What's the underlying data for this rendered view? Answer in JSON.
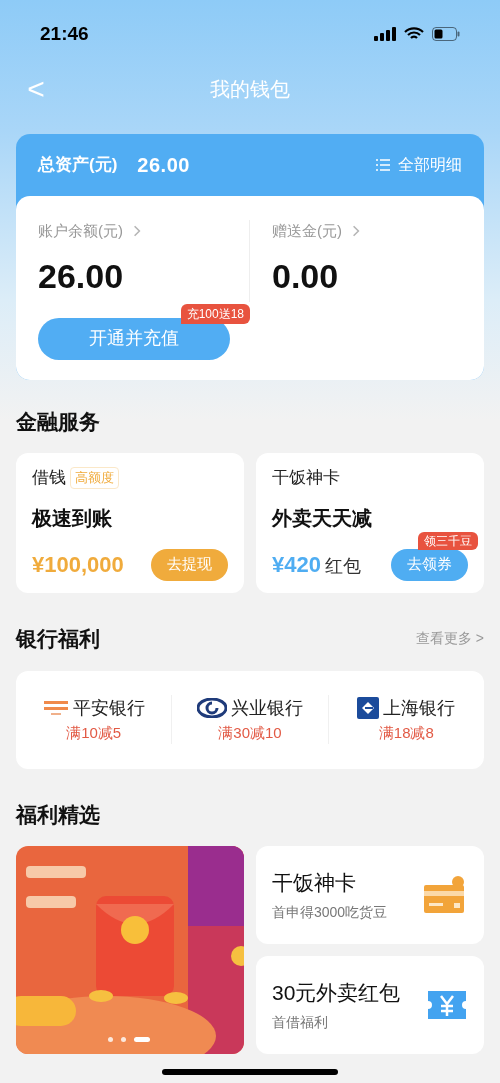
{
  "status_bar": {
    "time": "21:46"
  },
  "header": {
    "back": "<",
    "title": "我的钱包"
  },
  "assets": {
    "label": "总资产(元)",
    "total": "26.00",
    "details": "全部明细",
    "balances": [
      {
        "label": "账户余额(元)",
        "value": "26.00"
      },
      {
        "label": "赠送金(元)",
        "value": "0.00"
      }
    ],
    "button": "开通并充值",
    "promo_badge": "充100送18"
  },
  "finance": {
    "title": "金融服务",
    "cards": [
      {
        "kind": "loan",
        "title": "借钱",
        "tag": "高额度",
        "headline": "极速到账",
        "amount": "¥100,000",
        "button": "去提现"
      },
      {
        "kind": "coupon",
        "title": "干饭神卡",
        "headline": "外卖天天减",
        "amount": "¥420",
        "amount_suffix": "红包",
        "button": "去领券",
        "badge": "领三千豆"
      }
    ]
  },
  "bank": {
    "title": "银行福利",
    "more": "查看更多 >",
    "items": [
      {
        "kind": "pingan",
        "name": "平安银行",
        "offer": "满10减5"
      },
      {
        "kind": "cib",
        "name": "兴业银行",
        "offer": "满30减10"
      },
      {
        "kind": "shanghai",
        "name": "上海银行",
        "offer": "满18减8"
      }
    ]
  },
  "picks": {
    "title": "福利精选",
    "carousel": [
      {
        "selected": false
      },
      {
        "selected": false
      },
      {
        "selected": true
      }
    ],
    "cards": [
      {
        "kind": "card",
        "title": "干饭神卡",
        "subtitle": "首申得3000吃货豆"
      },
      {
        "kind": "ticket",
        "title": "30元外卖红包",
        "subtitle": "首借福利"
      }
    ]
  }
}
